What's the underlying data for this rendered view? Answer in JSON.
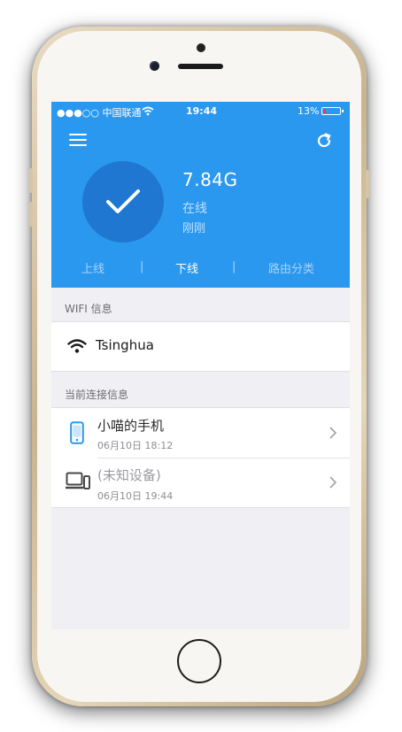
{
  "status_bar": {
    "carrier": "●●●○○ 中国联通",
    "time": "19:44",
    "battery_pct": "13%"
  },
  "header": {
    "usage": "7.84G",
    "state": "在线",
    "updated": "刚刚",
    "tabs": [
      {
        "label": "上线",
        "active": false
      },
      {
        "label": "下线",
        "active": true
      },
      {
        "label": "路由分类",
        "active": false
      }
    ],
    "separator": "|"
  },
  "wifi_section": {
    "title": "WIFI 信息",
    "ssid": "Tsinghua"
  },
  "connections_section": {
    "title": "当前连接信息",
    "devices": [
      {
        "name": "小喵的手机",
        "time": "06月10日 18:12",
        "icon": "phone-icon"
      },
      {
        "name": "(未知设备)",
        "time": "06月10日 19:44",
        "icon": "computer-icon"
      }
    ]
  },
  "colors": {
    "accent": "#2b98ef",
    "accent_dark": "#1f77d1",
    "background": "#efeff4"
  }
}
